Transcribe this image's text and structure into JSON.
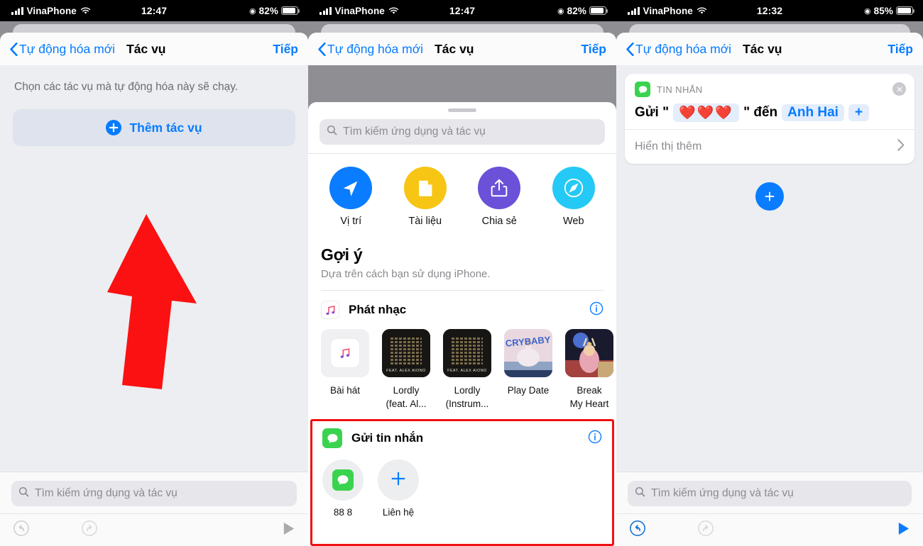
{
  "statusbars": [
    {
      "carrier": "VinaPhone",
      "time": "12:47",
      "battery": "82%"
    },
    {
      "carrier": "VinaPhone",
      "time": "12:47",
      "battery": "82%"
    },
    {
      "carrier": "VinaPhone",
      "time": "12:32",
      "battery": "85%"
    }
  ],
  "nav": {
    "back": "Tự động hóa mới",
    "title": "Tác vụ",
    "next": "Tiếp"
  },
  "panel1": {
    "hint": "Chọn các tác vụ mà tự động hóa này sẽ chạy.",
    "add_action": "Thêm tác vụ",
    "search_placeholder": "Tìm kiếm ứng dụng và tác vụ",
    "annotation": "red-up-arrow"
  },
  "panel2": {
    "search_placeholder": "Tìm kiếm ứng dụng và tác vụ",
    "apps": [
      {
        "label": "Vị trí",
        "icon": "location-arrow-icon",
        "color": "#0a7cff"
      },
      {
        "label": "Tài liệu",
        "icon": "document-icon",
        "color": "#f7c513"
      },
      {
        "label": "Chia sẻ",
        "icon": "share-icon",
        "color": "#6a51d8"
      },
      {
        "label": "Web",
        "icon": "safari-compass-icon",
        "color": "#25c9f5"
      }
    ],
    "suggestions_title": "Gợi ý",
    "suggestions_sub": "Dựa trên cách bạn sử dụng iPhone.",
    "music": {
      "name": "Phát nhạc",
      "icon": "music-note-icon",
      "cards": [
        {
          "label": "Bài hát",
          "art": "apple-music-icon"
        },
        {
          "label": "Lordly\n(feat. Al...",
          "art": "lordly-feat-album-art"
        },
        {
          "label": "Lordly\n(Instrum...",
          "art": "lordly-instrumental-album-art"
        },
        {
          "label": "Play Date",
          "art": "crybaby-album-art"
        },
        {
          "label": "Break\nMy Heart",
          "art": "break-my-heart-album-art"
        }
      ]
    },
    "messages": {
      "name": "Gửi tin nhắn",
      "icon": "messages-icon",
      "chips": [
        {
          "label": "88 8",
          "icon": "messages-icon"
        },
        {
          "label": "Liên hệ",
          "icon": "plus-icon"
        }
      ],
      "highlight_color": "#ef1111"
    }
  },
  "panel3": {
    "action_card": {
      "app": "TIN NHẮN",
      "app_icon": "messages-icon",
      "close_icon": "close-icon",
      "prefix": "Gửi \"",
      "message": "❤️❤️❤️",
      "middle": "\" đến",
      "recipient": "Anh Hai",
      "add_recipient": "+",
      "show_more": "Hiển thị thêm"
    },
    "add_button": "+",
    "search_placeholder": "Tìm kiếm ứng dụng và tác vụ"
  },
  "toolbar": {
    "undo": "undo-icon",
    "redo": "redo-icon",
    "play": "play-icon"
  },
  "colors": {
    "accent": "#067bff",
    "highlight": "#ef1111",
    "arrow": "#fb1111",
    "messages_green": "#3ad34f"
  }
}
